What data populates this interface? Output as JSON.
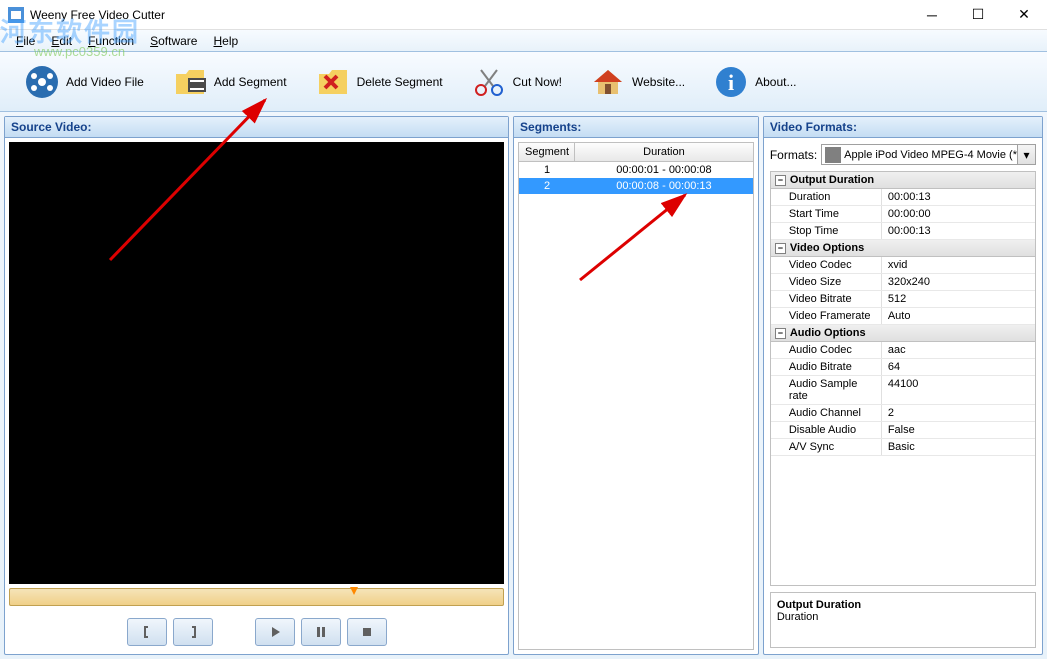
{
  "window": {
    "title": "Weeny Free Video Cutter",
    "watermark_text": "河东软件园",
    "watermark_url": "www.pc0359.cn"
  },
  "menu": {
    "file": "File",
    "edit": "Edit",
    "function": "Function",
    "software": "Software",
    "help": "Help"
  },
  "toolbar": {
    "add_video": "Add Video File",
    "add_segment": "Add Segment",
    "delete_segment": "Delete Segment",
    "cut_now": "Cut Now!",
    "website": "Website...",
    "about": "About..."
  },
  "panels": {
    "source": "Source Video:",
    "segments": "Segments:",
    "formats": "Video Formats:"
  },
  "segments": {
    "col_segment": "Segment",
    "col_duration": "Duration",
    "rows": [
      {
        "seg": "1",
        "dur": "00:00:01 - 00:00:08"
      },
      {
        "seg": "2",
        "dur": "00:00:08 - 00:00:13"
      }
    ],
    "selected": 1
  },
  "formats": {
    "label": "Formats:",
    "selected": "Apple iPod Video MPEG-4 Movie (*"
  },
  "props": {
    "groups": [
      {
        "title": "Output Duration",
        "items": [
          {
            "k": "Duration",
            "v": "00:00:13"
          },
          {
            "k": "Start Time",
            "v": "00:00:00"
          },
          {
            "k": "Stop Time",
            "v": "00:00:13"
          }
        ]
      },
      {
        "title": "Video Options",
        "items": [
          {
            "k": "Video Codec",
            "v": "xvid"
          },
          {
            "k": "Video Size",
            "v": "320x240"
          },
          {
            "k": "Video Bitrate",
            "v": "512"
          },
          {
            "k": "Video Framerate",
            "v": "Auto"
          }
        ]
      },
      {
        "title": "Audio Options",
        "items": [
          {
            "k": "Audio Codec",
            "v": "aac"
          },
          {
            "k": "Audio Bitrate",
            "v": "64"
          },
          {
            "k": "Audio Sample rate",
            "v": "44100"
          },
          {
            "k": "Audio Channel",
            "v": "2"
          },
          {
            "k": "Disable Audio",
            "v": "False"
          },
          {
            "k": "A/V Sync",
            "v": "Basic"
          }
        ]
      }
    ]
  },
  "output_box": {
    "title": "Output Duration",
    "text": "Duration"
  }
}
